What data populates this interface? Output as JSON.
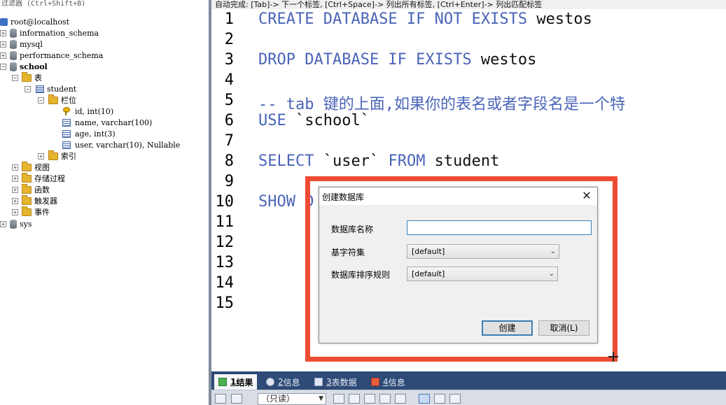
{
  "filter_hint": "过滤器 (Ctrl+Shift+B)",
  "tree": {
    "connection": "root@localhost",
    "databases": {
      "information_schema": "information_schema",
      "mysql": "mysql",
      "performance_schema": "performance_schema",
      "school": "school",
      "sys": "sys"
    },
    "tables_folder": "表",
    "table_student": "student",
    "columns_folder": "栏位",
    "columns": [
      "id, int(10)",
      "name, varchar(100)",
      "age, int(3)",
      "user, varchar(10), Nullable"
    ],
    "indexes_folder": "索引",
    "views_folder": "视图",
    "procedures_folder": "存储过程",
    "functions_folder": "函数",
    "triggers_folder": "触发器",
    "events_folder": "事件"
  },
  "autocomplete_hint": "自动完成: [Tab]-> 下一个标签, [Ctrl+Space]-> 列出所有标签, [Ctrl+Enter]-> 列出匹配标签",
  "editor": {
    "line_numbers": [
      "1",
      "2",
      "3",
      "4",
      "5",
      "6",
      "7",
      "8",
      "9",
      "10",
      "11",
      "12",
      "13",
      "14",
      "15"
    ],
    "line1": {
      "kw": "CREATE DATABASE IF NOT EXISTS",
      "rest": " westos"
    },
    "line3": {
      "kw": "DROP DATABASE IF EXISTS",
      "rest": " westos"
    },
    "line5": "-- tab 键的上面,如果你的表名或者字段名是一个特",
    "line6": {
      "kw": "USE",
      "rest": " `school`"
    },
    "line8": {
      "kw1": "SELECT",
      "mid": " `user` ",
      "kw2": "FROM",
      "rest": " student"
    },
    "line10": {
      "kw": "SHOW",
      "rest": " D"
    }
  },
  "result_tabs": [
    {
      "num": "1",
      "label": " 结果"
    },
    {
      "num": "2",
      "label": " 信息"
    },
    {
      "num": "3",
      "label": " 表数据"
    },
    {
      "num": "4",
      "label": " 信息"
    }
  ],
  "toolbar": {
    "readonly": "（只读）"
  },
  "dialog": {
    "title": "创建数据库",
    "close": "✕",
    "db_name_label": "数据库名称",
    "db_name_value": "",
    "charset_label": "基字符集",
    "charset_value": "[default]",
    "collation_label": "数据库排序规则",
    "collation_value": "[default]",
    "create_label": "创建",
    "cancel_label": "取消(L)"
  },
  "colors": {
    "keyword": "#4a64b8",
    "highlight": "#ee4b33",
    "tabs_bg": "#2e4a76"
  }
}
